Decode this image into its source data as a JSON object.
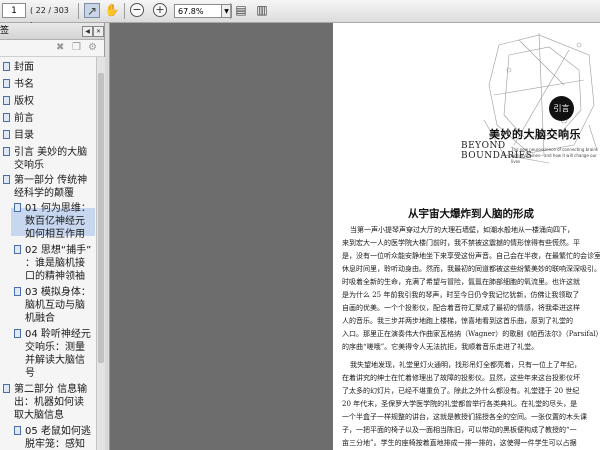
{
  "toolbar": {
    "page_number": "1",
    "page_count": "( 22 / 303 )",
    "zoom": "67.8%"
  },
  "panel": {
    "title": "签",
    "items": [
      {
        "label": "封面"
      },
      {
        "label": "书名"
      },
      {
        "label": "版权"
      },
      {
        "label": "前言"
      },
      {
        "label": "目录"
      },
      {
        "label": "引言  美妙的大脑\n交响乐"
      },
      {
        "label": "第一部分  传统神\n经科学的颠覆"
      },
      {
        "label": "01  何为思维：\n数百亿神经元\n如何相互作用"
      },
      {
        "label": "02  思想“捕手”\n：谁是脑机接\n口的精神领袖"
      },
      {
        "label": "03  模拟身体：\n脑机互动与脑\n机融合"
      },
      {
        "label": "04  聆听神经元\n交响乐：测量\n并解读大脑信\n号"
      },
      {
        "label": "第二部分  信息输\n出：机器如何读\n取大脑信息"
      },
      {
        "label": "05  老鼠如何逃\n脱牢笼：感知"
      }
    ]
  },
  "document": {
    "intro_badge": "引言",
    "chapter_title": "美妙的大脑交响乐",
    "beyond": "BEYOND\nBOUNDARIES",
    "subtitle": "The new neuroscience of connecting brains with machines—and how it will change our lives",
    "section_title": "从宇宙大爆炸到人脑的形成",
    "para1": [
      "当第一声小提琴声穿过大厅的大理石墙壁，如潮水般地从一楼涌向四下，",
      "来到宏大一人的医学院大楼门前时，我不禁被这震撼的情形惊得有些慌然。平",
      "是，没有一位听众能安静地坐下来享受这份声音。自己会在半夜，在最繁忙的会诊室的安静",
      "休息时间里，聆听动身由。然而，我最初的同道都被这些纷繁美妙的联响深深吸引。它",
      "时吸着全新的生命，充满了希望与冒险，氤氲在肺部细胞的氧流里。也许这就",
      "是为什么 25 年前我引我的琴声，时至今日仍令我记忆犹新，仿佛让我领取了",
      "自画的优美。一个个投影仪，配合着音符汇聚成了最初的情感，将我牵进这样",
      "人的音乐。我三步并两步地跑上楼梯，惊喜地看到这首乐曲，原到了礼堂的",
      "入口。那里正在演奏伟大作曲家瓦格纳（Wagner）的歌剧《帕西法尔》（Parsifal）",
      "的序曲“嗟哦”。它美得令人无法抗拒，我顺着音乐走进了礼堂。"
    ],
    "para2": [
      "我失望地发现，礼堂里灯火通明，找形吊灯全都亮着，只有一位上了年纪，",
      "在着讲究的绅士在忙着修理出了故障的投影仪。显然，这些年来这台投影仪坏",
      "了太多的幻灯片，已经不堪重负了。除此之外什么都没有。礼堂建于 20 世纪",
      "20 年代末，圣保罗大学医学院的礼堂都曾举行各类典礼。在礼堂的尽头，是",
      "一个半盒子一样规整的讲台，这就是教授们摇授各全的空间。一张仅置的木头课",
      "子，一把平面的椅子以及一面相当陈旧，可以带动的黑板便构成了教授的“一",
      "亩三分地”。学生的座椅按着直地排成一排一排的，这使得一件学生可以占据"
    ]
  }
}
